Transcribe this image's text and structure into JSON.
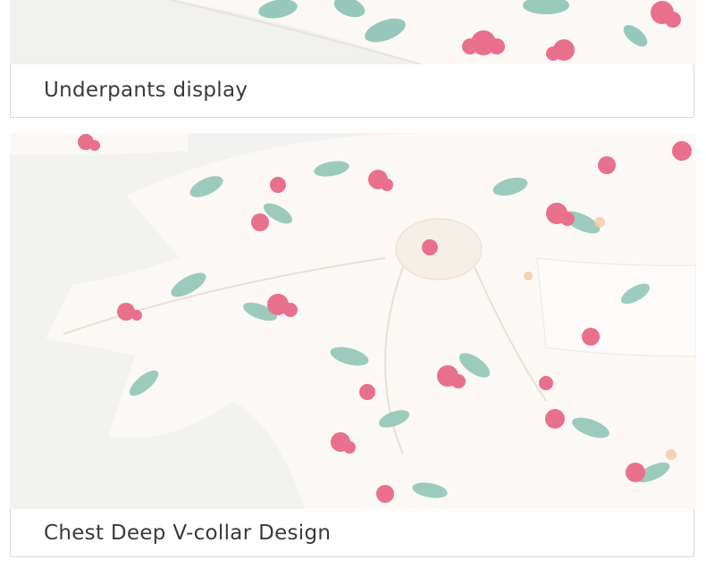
{
  "captions": {
    "top": "Underpants display",
    "bottom": "Chest Deep V-collar Design"
  },
  "images": {
    "top": "floral-chiffon-underpants-photo",
    "bottom": "floral-chiffon-chest-knot-photo"
  },
  "colors": {
    "fabric": "#fbf8f6",
    "leaf": "#8cc4b5",
    "flower": "#e8708d",
    "caption_text": "#3a3a3a",
    "border": "#dadada"
  }
}
